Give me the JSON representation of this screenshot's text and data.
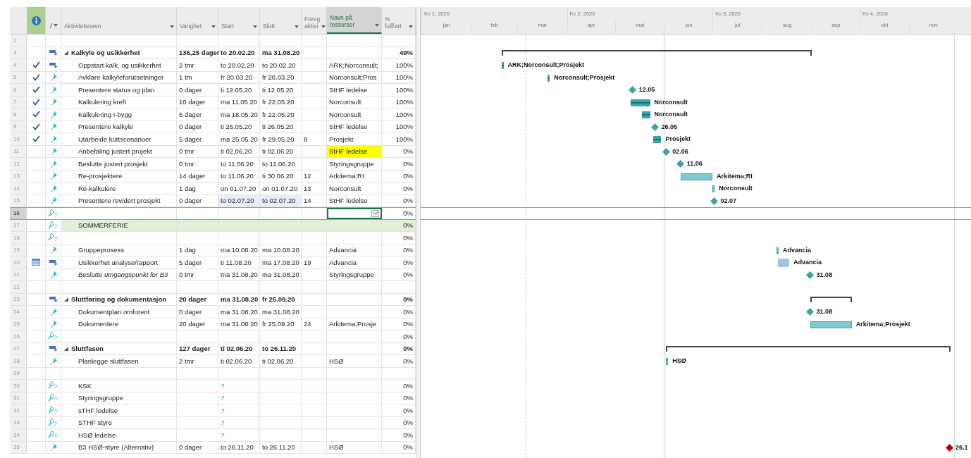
{
  "columns": [
    {
      "label": "Aktivitetsnavn",
      "selected": false
    },
    {
      "label": "Varighet",
      "selected": false
    },
    {
      "label": "Start",
      "selected": false
    },
    {
      "label": "Slutt",
      "selected": false
    },
    {
      "label": "Foreg aktivi",
      "selected": false
    },
    {
      "label": "Navn på ressurser",
      "selected": true
    },
    {
      "label": "% fullført",
      "selected": false
    }
  ],
  "timeline": {
    "quarters": [
      "Kv 1, 2020",
      "Kv 2, 2020",
      "Kv 3, 2020",
      "Kv 4, 2020"
    ],
    "months": [
      "jan",
      "feb",
      "mar",
      "apr",
      "mai",
      "jun",
      "jul",
      "aug",
      "sep",
      "okt",
      "nov"
    ]
  },
  "rows": [
    {
      "n": "2",
      "selected": false
    },
    {
      "n": "3",
      "selected": false,
      "mode": {
        "kind": "auto"
      },
      "name": "Kalkyle og usikkerhet",
      "duration": "136,25 dager",
      "start": "to 20.02.20",
      "finish": "ma 31.08.20",
      "percent": "49%",
      "expanded": true,
      "gantt": {
        "kind": "summary"
      },
      "children": [
        {
          "n": "4",
          "selected": false,
          "indicator": {
            "kind": "check"
          },
          "mode": {
            "kind": "auto"
          },
          "name": "Oppstart kalk. og usikkerhet",
          "duration": "2 tmr",
          "start": "to 20.02.20",
          "finish": "to 20.02.20",
          "resources": "ARK;Norconsult;",
          "percent": "100%",
          "gantt": {
            "kind": "task",
            "done": true,
            "label": "ARK;Norconsult;Prosjekt"
          }
        },
        {
          "n": "5",
          "selected": false,
          "indicator": {
            "kind": "check"
          },
          "mode": {
            "kind": "manual"
          },
          "name": "Avklare kalkyleforutsetninger",
          "duration": "1 tm",
          "start": "fr 20.03.20",
          "finish": "fr 20.03.20",
          "resources": "Norconsult;Pros",
          "percent": "100%",
          "gantt": {
            "kind": "task",
            "done": true,
            "label": "Norconsult;Prosjekt"
          }
        },
        {
          "n": "6",
          "selected": false,
          "indicator": {
            "kind": "check"
          },
          "mode": {
            "kind": "manual"
          },
          "name": "Presentere status og plan",
          "duration": "0 dager",
          "start": "ti 12.05.20",
          "finish": "ti 12.05.20",
          "resources": "StHF ledelse",
          "percent": "100%",
          "gantt": {
            "kind": "milestone",
            "label": "12.05"
          }
        },
        {
          "n": "7",
          "selected": false,
          "indicator": {
            "kind": "check"
          },
          "mode": {
            "kind": "manual"
          },
          "name": "Kalkulering kreft",
          "duration": "10 dager",
          "start": "ma 11.05.20",
          "finish": "fr 22.05.20",
          "resources": "Norconsult",
          "percent": "100%",
          "gantt": {
            "kind": "task",
            "done": true,
            "label": "Norconsult"
          }
        },
        {
          "n": "8",
          "selected": false,
          "indicator": {
            "kind": "check"
          },
          "mode": {
            "kind": "manual"
          },
          "name": "Kalkulering I-bygg",
          "duration": "5 dager",
          "start": "ma 18.05.20",
          "finish": "fr 22.05.20",
          "resources": "Norconsult",
          "percent": "100%",
          "gantt": {
            "kind": "task",
            "done": true,
            "label": "Norconsult"
          }
        },
        {
          "n": "9",
          "selected": false,
          "indicator": {
            "kind": "check"
          },
          "mode": {
            "kind": "manual"
          },
          "name": "Presentere kalkyle",
          "duration": "0 dager",
          "start": "ti 26.05.20",
          "finish": "ti 26.05.20",
          "resources": "StHF ledelse",
          "percent": "100%",
          "gantt": {
            "kind": "milestone",
            "label": "26.05"
          }
        },
        {
          "n": "10",
          "selected": false,
          "indicator": {
            "kind": "check"
          },
          "mode": {
            "kind": "manual"
          },
          "name": "Utarbeide kuttscenarioer",
          "duration": "5 dager",
          "start": "ma 25.05.20",
          "finish": "fr 29.05.20",
          "predecessors": "8",
          "resources": "Prosjekt",
          "percent": "100%",
          "gantt": {
            "kind": "task",
            "done": true,
            "label": "Prosjekt"
          }
        },
        {
          "n": "11",
          "selected": false,
          "mode": {
            "kind": "manual"
          },
          "name": "Anbefaling justert projekt",
          "duration": "0 tmr",
          "start": "ti 02.06.20",
          "finish": "ti 02.06.20",
          "resources": "StHF ledelse",
          "resources_highlighted": true,
          "percent": "0%",
          "gantt": {
            "kind": "milestone",
            "label": "02.06"
          }
        },
        {
          "n": "12",
          "selected": false,
          "mode": {
            "kind": "manual"
          },
          "name": "Beslutte justert prosjekt",
          "duration": "0 tmr",
          "start": "to 11.06.20",
          "finish": "to 11.06.20",
          "resources": "Styringsgruppe",
          "percent": "0%",
          "gantt": {
            "kind": "milestone",
            "label": "11.06"
          }
        },
        {
          "n": "13",
          "selected": false,
          "mode": {
            "kind": "manual"
          },
          "name": "Re-prosjektere",
          "duration": "14 dager",
          "start": "to 11.06.20",
          "finish": "ti 30.06.20",
          "predecessors": "12",
          "resources": "Arkitema;RI",
          "percent": "0%",
          "gantt": {
            "kind": "task",
            "done": false,
            "label": "Arkitema;RI"
          }
        },
        {
          "n": "14",
          "selected": false,
          "mode": {
            "kind": "manual"
          },
          "name": "Re-kalkulere",
          "duration": "1 dag",
          "start": "on 01.07.20",
          "finish": "on 01.07.20",
          "predecessors": "13",
          "resources": "Norconsult",
          "percent": "0%",
          "gantt": {
            "kind": "task",
            "done": false,
            "label": "Norconsult"
          }
        },
        {
          "n": "15",
          "selected": false,
          "mode": {
            "kind": "manual"
          },
          "name": "Presentere revidert prosjekt",
          "duration": "0 dager",
          "start": "to 02.07.20",
          "finish": "to 02.07.20",
          "dates_highlighted": true,
          "predecessors": "14",
          "resources": "StHF ledelse",
          "percent": "0%",
          "gantt": {
            "kind": "milestone",
            "label": "02.07"
          }
        },
        {
          "n": "16",
          "selected": true,
          "mode": {
            "kind": "unscheduled"
          },
          "percent": "0%"
        },
        {
          "n": "17",
          "selected": false,
          "shaded": true,
          "mode": {
            "kind": "unscheduled"
          },
          "name": "SOMMERFERIE",
          "percent": "0%"
        },
        {
          "n": "18",
          "selected": false,
          "mode": {
            "kind": "unscheduled"
          },
          "percent": "0%"
        },
        {
          "n": "19",
          "selected": false,
          "mode": {
            "kind": "manual"
          },
          "name": "Gruppeprosess",
          "duration": "1 dag",
          "start": "ma 10.08.20",
          "finish": "ma 10.08.20",
          "resources": "Advancia",
          "percent": "0%",
          "gantt": {
            "kind": "task",
            "done": false,
            "label": "Advancia"
          }
        },
        {
          "n": "20",
          "selected": false,
          "indicator": {
            "kind": "calendar"
          },
          "mode": {
            "kind": "auto"
          },
          "name": "Usikkerhet analyse/rapport",
          "duration": "5 dager",
          "start": "ti 11.08.20",
          "finish": "ma 17.08.20",
          "predecessors": "19",
          "resources": "Advancia",
          "percent": "0%",
          "gantt": {
            "kind": "manual",
            "label": "Advancia"
          }
        },
        {
          "n": "21",
          "selected": false,
          "italic": true,
          "mode": {
            "kind": "manual"
          },
          "name": "Beslutte utngangspunkt for B3",
          "duration": "0 tmr",
          "start": "ma 31.08.20",
          "finish": "ma 31.08.20",
          "resources": "Styringsgruppe",
          "percent": "0%",
          "gantt": {
            "kind": "milestone",
            "label": "31.08"
          }
        }
      ]
    },
    {
      "n": "22",
      "selected": false
    },
    {
      "n": "23",
      "selected": false,
      "mode": {
        "kind": "auto"
      },
      "name": "Sluttføring og dokumentasjon",
      "duration": "20 dager",
      "start": "ma 31.08.20",
      "finish": "fr 25.09.20",
      "percent": "0%",
      "expanded": true,
      "gantt": {
        "kind": "summary"
      },
      "children": [
        {
          "n": "24",
          "selected": false,
          "mode": {
            "kind": "manual"
          },
          "name": "Dokumentplan omforent",
          "duration": "0 dager",
          "start": "ma 31.08.20",
          "finish": "ma 31.08.20",
          "percent": "0%",
          "gantt": {
            "kind": "milestone",
            "label": "31.08"
          }
        },
        {
          "n": "25",
          "selected": false,
          "mode": {
            "kind": "manual"
          },
          "name": "Dokumentere",
          "duration": "20 dager",
          "start": "ma 31.08.20",
          "finish": "fr 25.09.20",
          "predecessors": "24",
          "resources": "Arkitema;Prosje",
          "percent": "0%",
          "gantt": {
            "kind": "task",
            "done": false,
            "label": "Arkitema;Prosjekt"
          }
        }
      ]
    },
    {
      "n": "26",
      "selected": false,
      "mode": {
        "kind": "unscheduled"
      },
      "percent": "0%"
    },
    {
      "n": "27",
      "selected": false,
      "mode": {
        "kind": "auto"
      },
      "name": "Sluttfasen",
      "duration": "127 dager",
      "start": "ti 02.06.20",
      "finish": "to 26.11.20",
      "percent": "0%",
      "expanded": true,
      "gantt": {
        "kind": "summary"
      },
      "children": [
        {
          "n": "28",
          "selected": false,
          "mode": {
            "kind": "manual"
          },
          "name": "Planlegge sluttfasen",
          "duration": "2 tmr",
          "start": "ti 02.06.20",
          "finish": "ti 02.06.20",
          "resources": "HSØ",
          "percent": "0%",
          "gantt": {
            "kind": "task",
            "done": false,
            "label": "HSØ"
          }
        },
        {
          "n": "29",
          "selected": false
        },
        {
          "n": "30",
          "selected": false,
          "mode": {
            "kind": "unscheduled"
          },
          "name": "KSK",
          "start": "?",
          "percent": "0%"
        },
        {
          "n": "31",
          "selected": false,
          "mode": {
            "kind": "unscheduled"
          },
          "name": "Styringsgruppe",
          "start": "?",
          "percent": "0%"
        },
        {
          "n": "32",
          "selected": false,
          "mode": {
            "kind": "unscheduled"
          },
          "name": "sTHF ledelse",
          "start": "?",
          "percent": "0%"
        },
        {
          "n": "33",
          "selected": false,
          "mode": {
            "kind": "unscheduled"
          },
          "name": "STHF styre",
          "start": "?",
          "percent": "0%"
        },
        {
          "n": "34",
          "selected": false,
          "mode": {
            "kind": "unscheduled"
          },
          "name": "HSØ ledelse",
          "start": "?",
          "percent": "0%"
        },
        {
          "n": "35",
          "selected": false,
          "mode": {
            "kind": "manual"
          },
          "name": "B3 HSØ-styre (Alternativ)",
          "duration": "0 dager",
          "start": "to 26.11.20",
          "finish": "to 26.11.20",
          "resources": "HSØ",
          "percent": "0%",
          "gantt": {
            "kind": "deadline",
            "label": "26.1"
          }
        }
      ]
    }
  ]
}
